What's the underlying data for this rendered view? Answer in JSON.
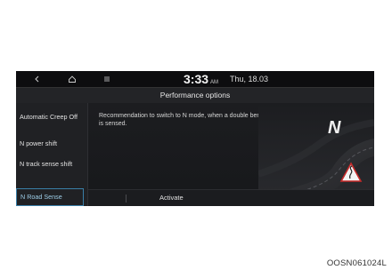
{
  "topbar": {
    "back_icon": "chevron-left-icon",
    "home_icon": "home-icon",
    "menu_icon": "menu-icon",
    "time": "3:33",
    "ampm": "AM",
    "date": "Thu, 18.03"
  },
  "screen_title": "Performance options",
  "sidebar": {
    "items": [
      {
        "label": "Automatic Creep Off"
      },
      {
        "label": "N power shift"
      },
      {
        "label": "N track sense shift"
      },
      {
        "label": "N Road Sense"
      }
    ]
  },
  "main": {
    "description": "Recommendation to switch to N mode, when a double bend sign is sensed.",
    "activate_label": "Activate",
    "logo_text": "N"
  },
  "caption": "OOSN061024L",
  "colors": {
    "accent": "#3a7fa8",
    "background": "#1b1c1f"
  }
}
